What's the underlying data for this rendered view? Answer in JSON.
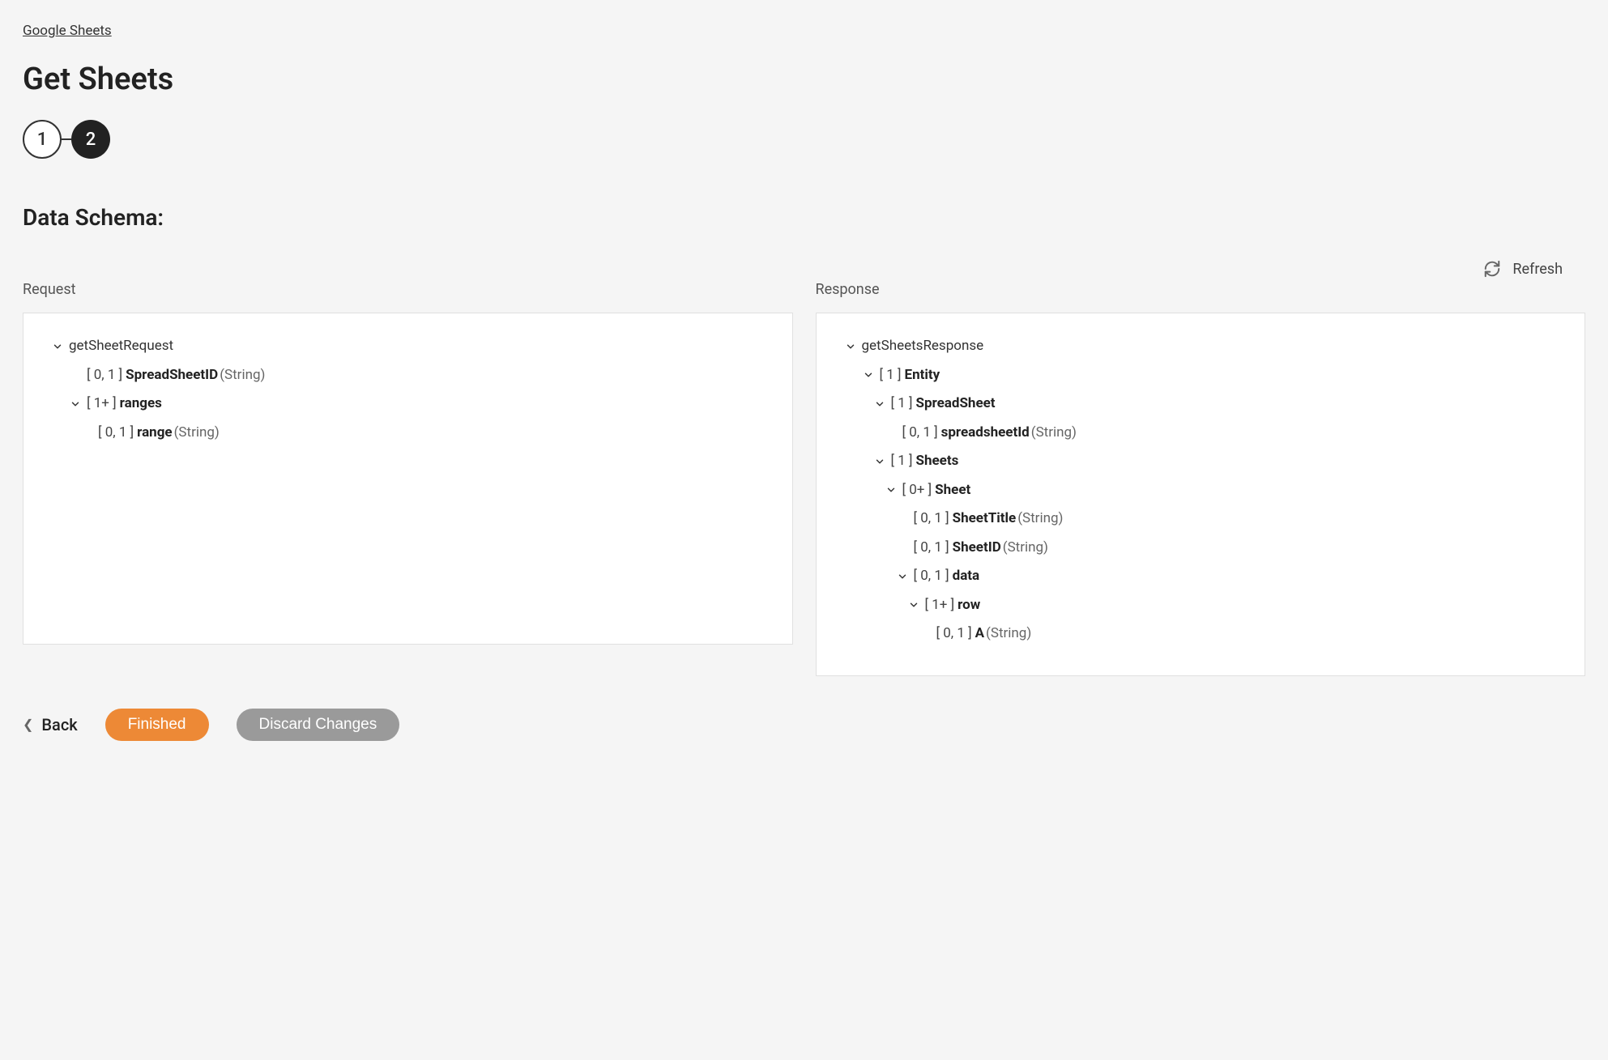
{
  "breadcrumb": "Google Sheets",
  "page_title": "Get Sheets",
  "stepper": {
    "step1": "1",
    "step2": "2"
  },
  "section_title": "Data Schema:",
  "refresh_label": "Refresh",
  "columns": {
    "request_header": "Request",
    "response_header": "Response"
  },
  "request_tree": [
    {
      "indent": 0,
      "chevron": true,
      "name": "getSheetRequest",
      "cardinality": "",
      "type": ""
    },
    {
      "indent": 1,
      "chevron": false,
      "name": "SpreadSheetID",
      "cardinality": "[ 0, 1 ]",
      "type": "(String)"
    },
    {
      "indent": 1,
      "chevron": true,
      "name": "ranges",
      "cardinality": "[ 1+ ]",
      "type": ""
    },
    {
      "indent": 2,
      "chevron": false,
      "name": "range",
      "cardinality": "[ 0, 1 ]",
      "type": "(String)"
    }
  ],
  "response_tree": [
    {
      "indent": 0,
      "chevron": true,
      "name": "getSheetsResponse",
      "cardinality": "",
      "type": ""
    },
    {
      "indent": 1,
      "chevron": true,
      "name": "Entity",
      "cardinality": "[ 1 ]",
      "type": ""
    },
    {
      "indent": 2,
      "chevron": true,
      "name": "SpreadSheet",
      "cardinality": "[ 1 ]",
      "type": ""
    },
    {
      "indent": 3,
      "chevron": false,
      "name": "spreadsheetId",
      "cardinality": "[ 0, 1 ]",
      "type": "(String)"
    },
    {
      "indent": 2,
      "chevron": true,
      "name": "Sheets",
      "cardinality": "[ 1 ]",
      "type": ""
    },
    {
      "indent": 3,
      "chevron": true,
      "name": "Sheet",
      "cardinality": "[ 0+ ]",
      "type": ""
    },
    {
      "indent": 4,
      "chevron": false,
      "name": "SheetTitle",
      "cardinality": "[ 0, 1 ]",
      "type": "(String)"
    },
    {
      "indent": 4,
      "chevron": false,
      "name": "SheetID",
      "cardinality": "[ 0, 1 ]",
      "type": "(String)"
    },
    {
      "indent": 4,
      "chevron": true,
      "name": "data",
      "cardinality": "[ 0, 1 ]",
      "type": ""
    },
    {
      "indent": 5,
      "chevron": true,
      "name": "row",
      "cardinality": "[ 1+ ]",
      "type": ""
    },
    {
      "indent": 6,
      "chevron": false,
      "name": "A",
      "cardinality": "[ 0, 1 ]",
      "type": "(String)"
    }
  ],
  "footer": {
    "back": "Back",
    "finished": "Finished",
    "discard": "Discard Changes"
  }
}
